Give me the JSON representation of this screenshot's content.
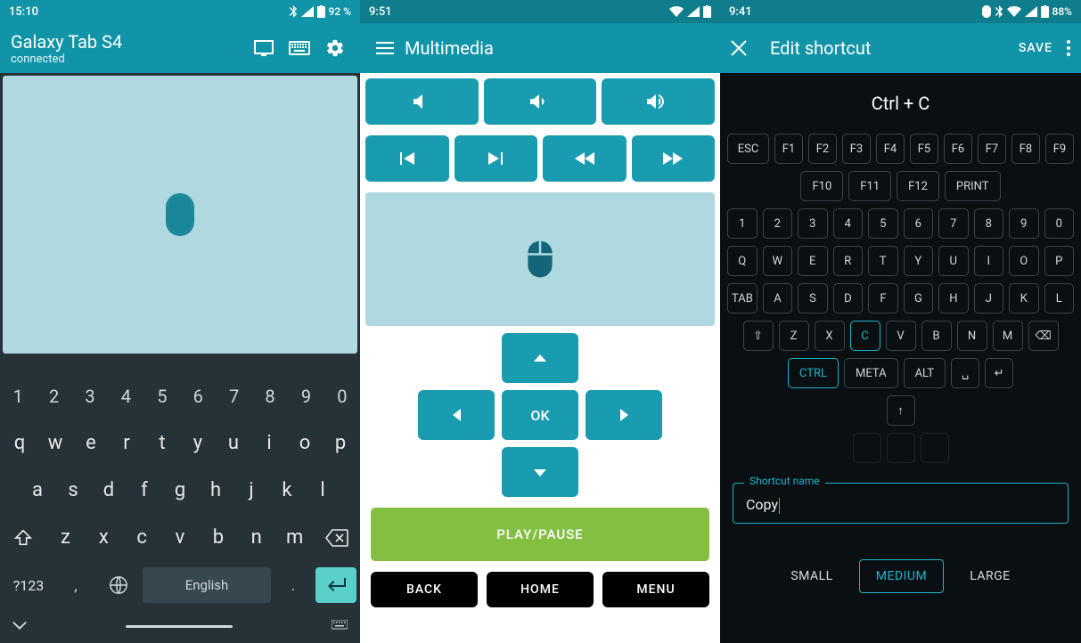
{
  "panel1": {
    "status_time": "15:10",
    "status_battery": "92 %",
    "title": "Galaxy Tab S4",
    "subtitle": "connected",
    "kbd": {
      "row1": [
        "1",
        "2",
        "3",
        "4",
        "5",
        "6",
        "7",
        "8",
        "9",
        "0"
      ],
      "row2": [
        "q",
        "w",
        "e",
        "r",
        "t",
        "y",
        "u",
        "i",
        "o",
        "p"
      ],
      "row3": [
        "a",
        "s",
        "d",
        "f",
        "g",
        "h",
        "j",
        "k",
        "l"
      ],
      "row4": [
        "z",
        "x",
        "c",
        "v",
        "b",
        "n",
        "m"
      ],
      "sym": "?123",
      "language": "English",
      "comma": ",",
      "dot": "."
    }
  },
  "panel2": {
    "status_time": "9:51",
    "title": "Multimedia",
    "ok": "OK",
    "play": "PLAY/PAUSE",
    "nav": [
      "BACK",
      "HOME",
      "MENU"
    ]
  },
  "panel3": {
    "status_time": "9:41",
    "status_battery": "88%",
    "title": "Edit shortcut",
    "save": "SAVE",
    "combo": "Ctrl + C",
    "frow1": [
      "ESC",
      "F1",
      "F2",
      "F3",
      "F4",
      "F5",
      "F6",
      "F7",
      "F8",
      "F9"
    ],
    "frow2": [
      "F10",
      "F11",
      "F12",
      "PRINT"
    ],
    "numrow": [
      "1",
      "2",
      "3",
      "4",
      "5",
      "6",
      "7",
      "8",
      "9",
      "0"
    ],
    "qrow": [
      "Q",
      "W",
      "E",
      "R",
      "T",
      "Y",
      "U",
      "I",
      "O",
      "P"
    ],
    "arow": [
      "TAB",
      "A",
      "S",
      "D",
      "F",
      "G",
      "H",
      "J",
      "K",
      "L"
    ],
    "zrow": [
      "⇧",
      "Z",
      "X",
      "C",
      "V",
      "B",
      "N",
      "M",
      "⌫"
    ],
    "modrow": [
      "CTRL",
      "META",
      "ALT",
      "␣",
      "↵"
    ],
    "arrowkey": "↑",
    "field_label": "Shortcut name",
    "field_value": "Copy",
    "sizes": [
      "SMALL",
      "MEDIUM",
      "LARGE"
    ],
    "selected_size": "MEDIUM",
    "selected_keys": [
      "CTRL",
      "C"
    ]
  }
}
